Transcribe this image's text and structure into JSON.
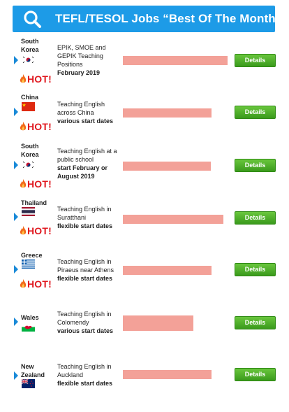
{
  "header": {
    "title": "TEFL/TESOL Jobs “Best Of The Month”",
    "icon": "search-icon",
    "color": "#1d9be7"
  },
  "hot_label": "HOT!",
  "details_label": "Details",
  "jobs": [
    {
      "country": "South Korea",
      "flag": "south-korea-flag-icon",
      "hot": true,
      "desc": "EPIK, SMOE and GEPIK Teaching Positions",
      "date": "February 2019"
    },
    {
      "country": "China",
      "flag": "china-flag-icon",
      "hot": true,
      "desc": "Teaching English across China",
      "date": "various start dates"
    },
    {
      "country": "South Korea",
      "flag": "south-korea-flag-icon",
      "hot": true,
      "desc": "Teaching English at a public school",
      "date": "start February or August 2019"
    },
    {
      "country": "Thailand",
      "flag": "thailand-flag-icon",
      "hot": true,
      "desc": "Teaching English in Suratthani",
      "date": "flexible start dates"
    },
    {
      "country": "Greece",
      "flag": "greece-flag-icon",
      "hot": true,
      "desc": "Teaching English in Piraeus near Athens",
      "date": "flexible start dates"
    },
    {
      "country": "Wales",
      "flag": "wales-flag-icon",
      "hot": false,
      "desc": "Teaching English in Colomendy",
      "date": "various start dates"
    },
    {
      "country": "New Zealand",
      "flag": "new-zealand-flag-icon",
      "hot": false,
      "desc": "Teaching English in Auckland",
      "date": "flexible start dates"
    }
  ]
}
